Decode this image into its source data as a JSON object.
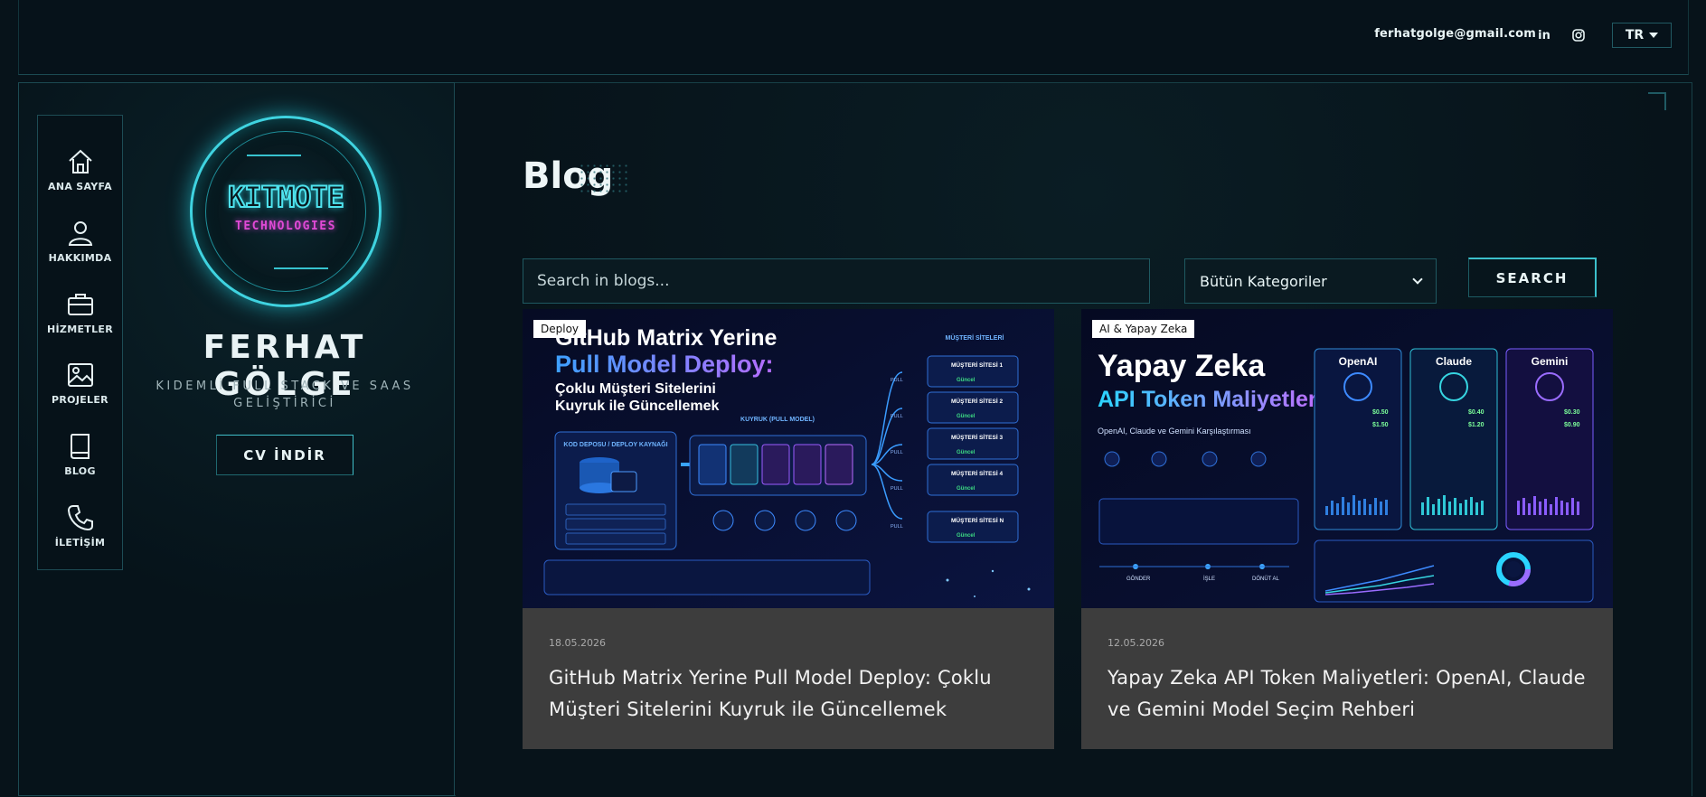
{
  "header": {
    "email": "ferhatgolge@gmail.com",
    "social": [
      {
        "icon": "linkedin-icon",
        "label": "in"
      },
      {
        "icon": "instagram-icon"
      }
    ],
    "language": "TR"
  },
  "sidebar": {
    "nav": [
      {
        "label": "ANA SAYFA",
        "icon": "home-icon"
      },
      {
        "label": "HAKKIMDA",
        "icon": "user-icon"
      },
      {
        "label": "HİZMETLER",
        "icon": "briefcase-icon"
      },
      {
        "label": "PROJELER",
        "icon": "image-icon"
      },
      {
        "label": "BLOG",
        "icon": "book-icon"
      },
      {
        "label": "İLETİŞİM",
        "icon": "phone-icon"
      }
    ],
    "logo": {
      "line1": "KITMOTE",
      "line2": "TECHNOLOGIES"
    },
    "name": "FERHAT GÖLGE",
    "subtitle": "KIDEMLİ FULL STACK VE SAAS GELİŞTİRİCİ",
    "cv_button": "CV İNDİR"
  },
  "main": {
    "title": "Blog",
    "search": {
      "placeholder": "Search in blogs...",
      "value": ""
    },
    "category_select": "Bütün Kategoriler",
    "search_button": "SEARCH",
    "posts": [
      {
        "tag": "Deploy",
        "date": "18.05.2026",
        "title": "GitHub Matrix Yerine Pull Model Deploy: Çoklu Müşteri Sitelerini Kuyruk ile Güncellemek",
        "image": {
          "headline1": "GitHub Matrix Yerine",
          "headline2": "Pull Model Deploy:",
          "headline3": "Çoklu Müşteri Sitelerini",
          "headline4": "Kuyruk ile Güncellemek",
          "source_box": "KOD DEPOSU / DEPLOY KAYNAĞI",
          "queue_label": "KUYRUK (PULL MODEL)",
          "sites_label": "MÜŞTERİ SİTELERİ",
          "sites": [
            "MÜŞTERİ SİTESİ 1",
            "MÜŞTERİ SİTESİ 2",
            "MÜŞTERİ SİTESİ 3",
            "MÜŞTERİ SİTESİ 4",
            "MÜŞTERİ SİTESİ N"
          ],
          "status": "Güncel",
          "pull": "PULL"
        }
      },
      {
        "tag": "AI & Yapay Zeka",
        "date": "12.05.2026",
        "title": "Yapay Zeka API Token Maliyetleri: OpenAI, Claude ve Gemini Model Seçim Rehberi",
        "image": {
          "headline1": "Yapay Zeka",
          "headline2": "API Token Maliyetleri",
          "subline": "OpenAI, Claude ve Gemini Karşılaştırması",
          "providers": [
            {
              "name": "OpenAI",
              "in": "$0.50",
              "out": "$1.50"
            },
            {
              "name": "Claude",
              "in": "$0.40",
              "out": "$1.20"
            },
            {
              "name": "Gemini",
              "in": "$0.30",
              "out": "$0.90"
            }
          ],
          "flow": [
            "GÖNDER",
            "İŞLE",
            "DÖNÜT AL"
          ]
        }
      }
    ]
  },
  "colors": {
    "accent": "#3fd3e0",
    "magenta": "#e04ad6",
    "card_bg": "#3d3d3d",
    "page_bg": "#07131a"
  }
}
